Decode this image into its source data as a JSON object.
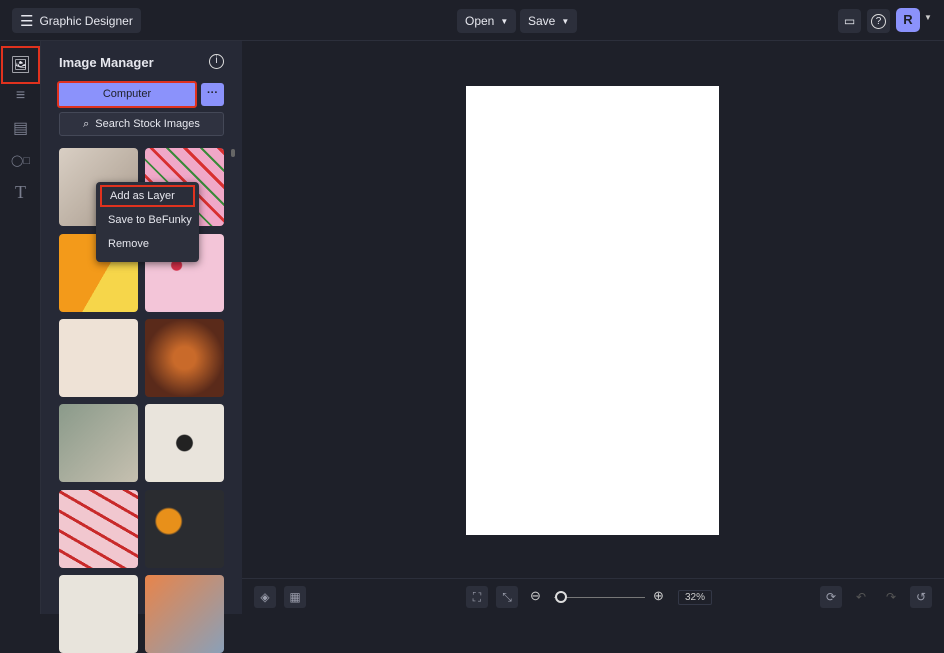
{
  "header": {
    "app_title": "Graphic Designer",
    "open_label": "Open",
    "save_label": "Save",
    "avatar_initial": "R"
  },
  "panel": {
    "title": "Image Manager",
    "computer_label": "Computer",
    "more_label": "···",
    "search_label": "Search Stock Images"
  },
  "context_menu": {
    "items": [
      "Add as Layer",
      "Save to BeFunky",
      "Remove"
    ]
  },
  "zoom": {
    "value": "32%",
    "slider_fraction": 0.05
  },
  "colors": {
    "accent": "#8b92fb",
    "highlight": "#e0321e"
  }
}
